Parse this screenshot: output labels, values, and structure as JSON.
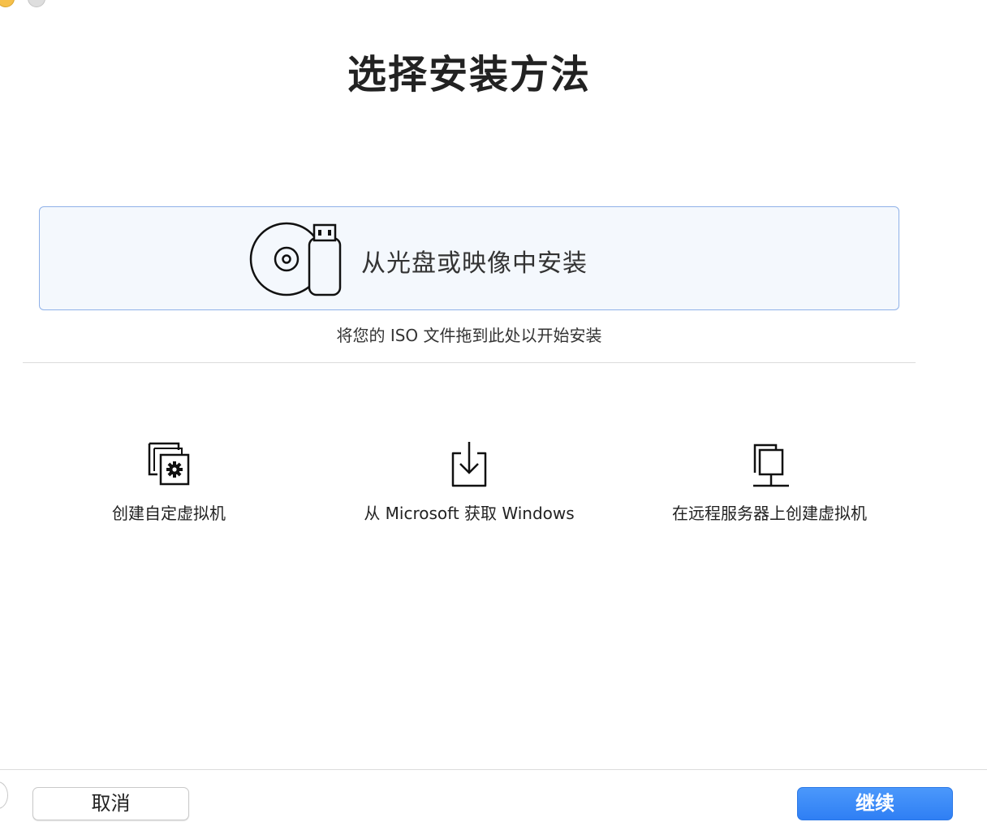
{
  "window": {
    "title": "选择安装方法"
  },
  "install_from_media": {
    "label": "从光盘或映像中安装",
    "icon": "disc-usb-icon",
    "hint": "将您的 ISO 文件拖到此处以开始安装"
  },
  "options": [
    {
      "label": "创建自定虚拟机",
      "icon": "custom-vm-gear-icon"
    },
    {
      "label": "从 Microsoft 获取 Windows",
      "icon": "download-tray-icon"
    },
    {
      "label": "在远程服务器上创建虚拟机",
      "icon": "remote-server-icon"
    }
  ],
  "footer": {
    "cancel_label": "取消",
    "continue_label": "继续"
  },
  "colors": {
    "accent": "#2f7ff4",
    "drop_zone_border": "#8fb1e8",
    "drop_zone_background": "#f4f8fd"
  }
}
